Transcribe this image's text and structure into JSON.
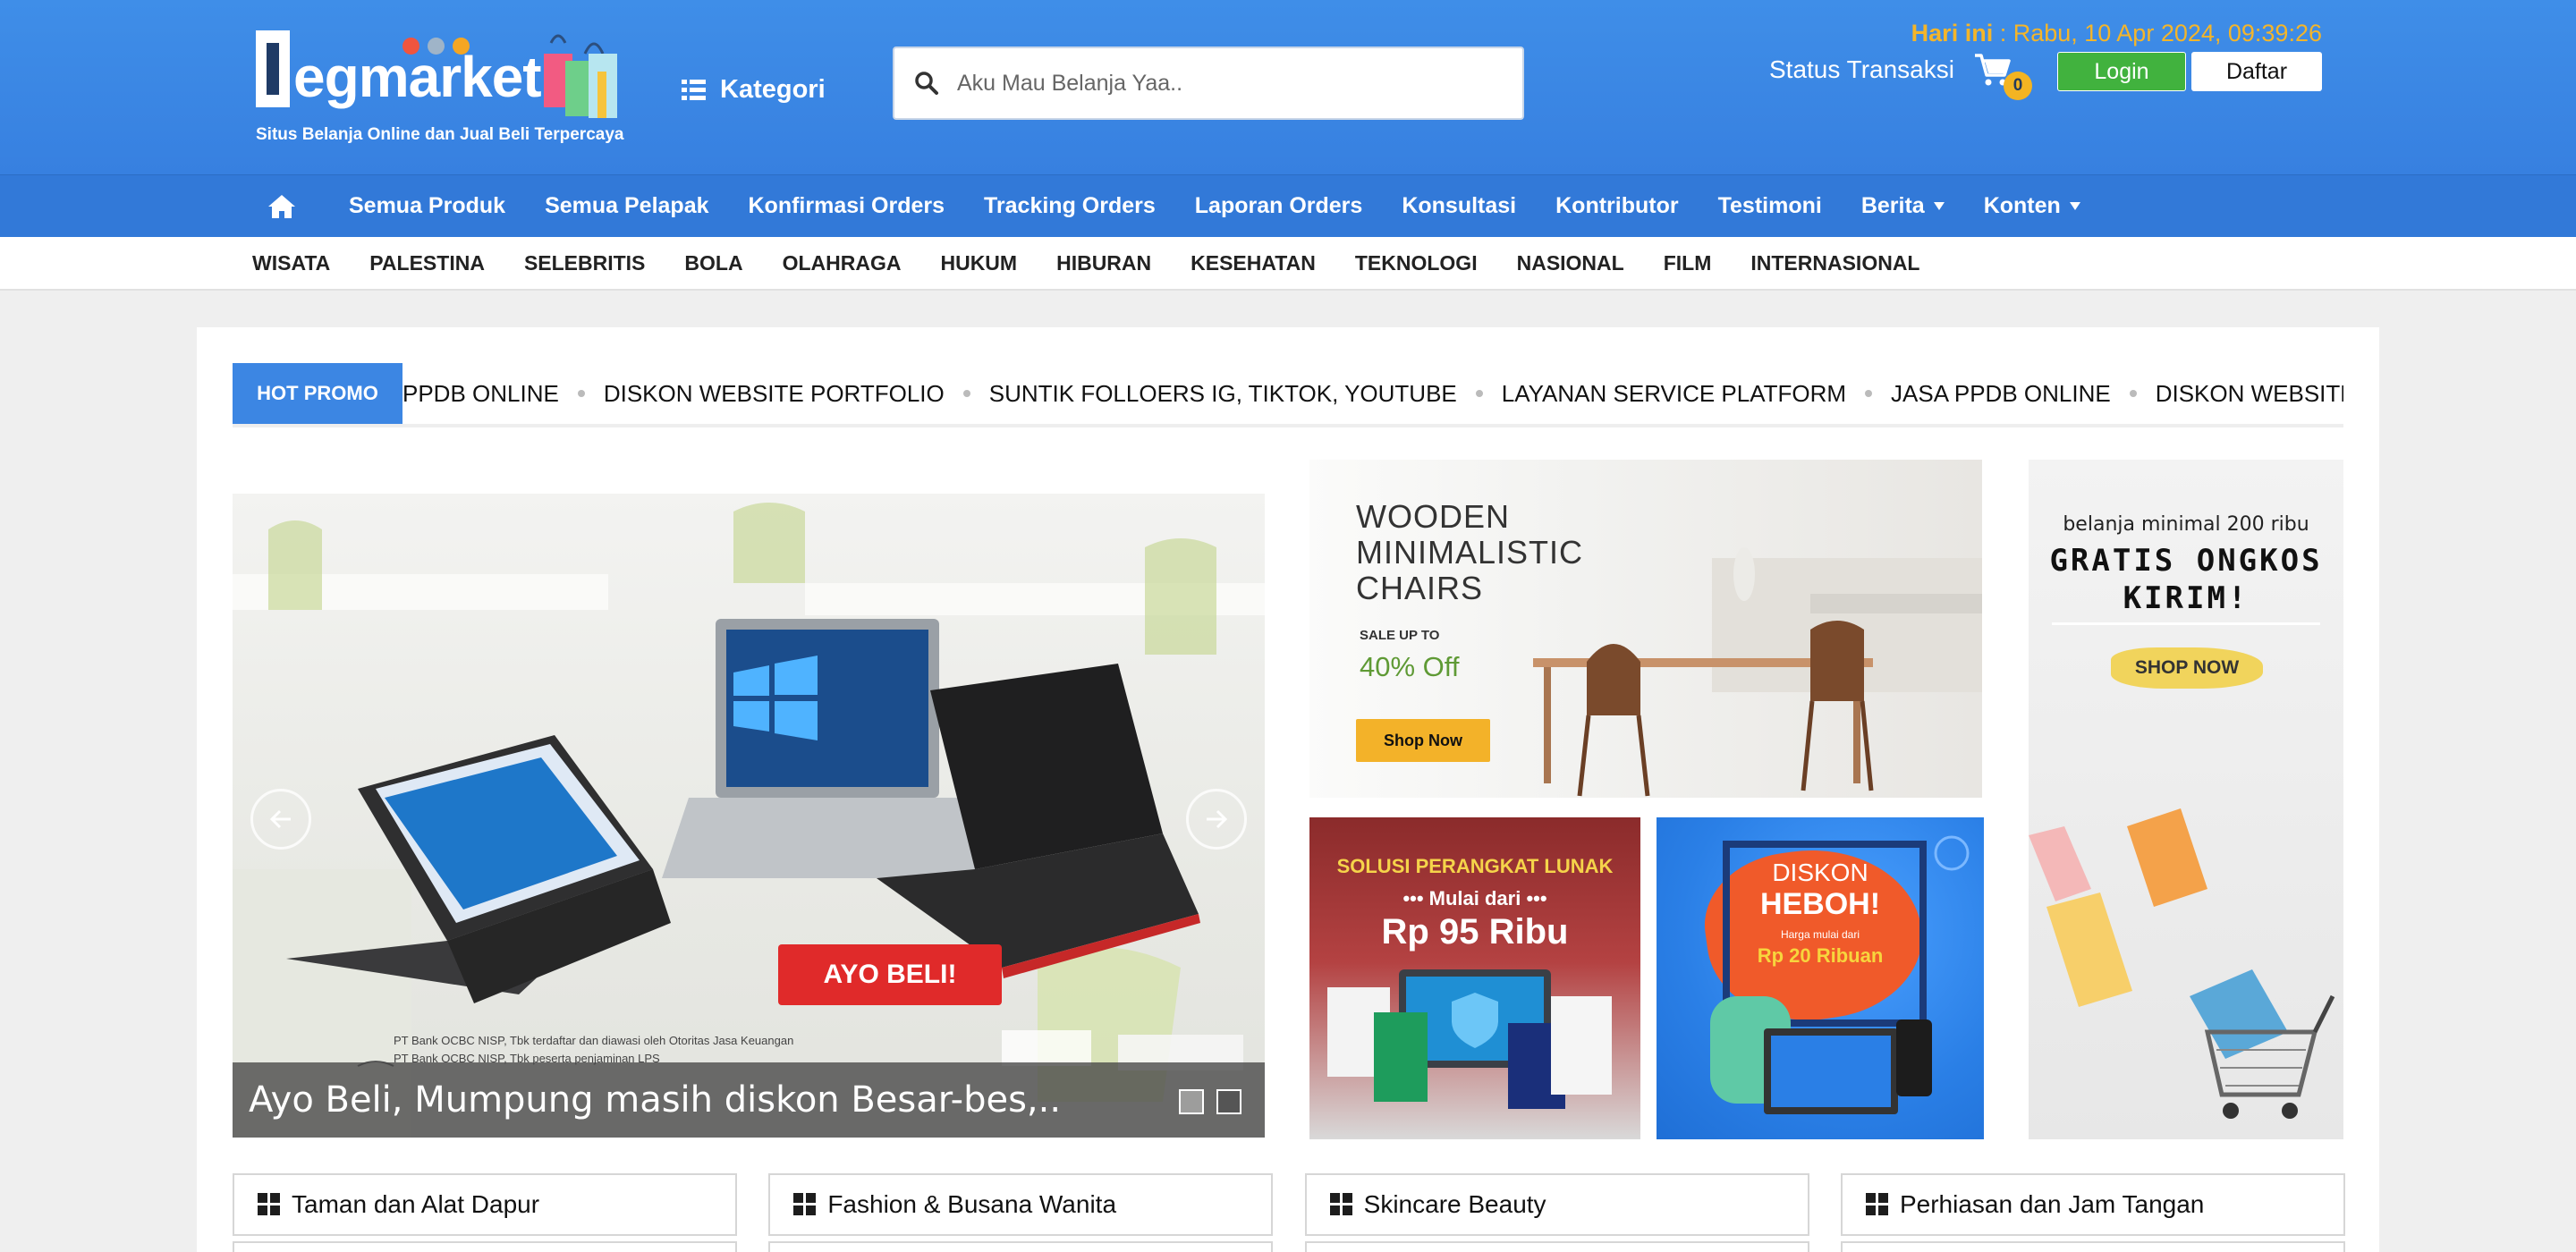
{
  "header": {
    "logo_text": "egmarket",
    "logo_tagline": "Situs Belanja Online dan Jual Beli Terpercaya",
    "kategori_label": "Kategori",
    "search_placeholder": "Aku Mau Belanja Yaa..",
    "date_label": "Hari ini",
    "date_value": " : Rabu, 10 Apr 2024, 09:39:26",
    "status_label": "Status Transaksi",
    "cart_count": "0",
    "login_label": "Login",
    "daftar_label": "Daftar"
  },
  "main_nav": [
    {
      "label": "Semua Produk"
    },
    {
      "label": "Semua Pelapak"
    },
    {
      "label": "Konfirmasi Orders"
    },
    {
      "label": "Tracking Orders"
    },
    {
      "label": "Laporan Orders"
    },
    {
      "label": "Konsultasi"
    },
    {
      "label": "Kontributor"
    },
    {
      "label": "Testimoni"
    },
    {
      "label": "Berita"
    },
    {
      "label": "Konten"
    }
  ],
  "category_nav": [
    "WISATA",
    "PALESTINA",
    "SELEBRITIS",
    "BOLA",
    "OLAHRAGA",
    "HUKUM",
    "HIBURAN",
    "KESEHATAN",
    "TEKNOLOGI",
    "NASIONAL",
    "FILM",
    "INTERNASIONAL"
  ],
  "hot_promo": {
    "label": "HOT PROMO",
    "items": [
      "PPDB ONLINE",
      "DISKON WEBSITE PORTFOLIO",
      "SUNTIK FOLLOERS IG, TIKTOK, YOUTUBE",
      "LAYANAN SERVICE PLATFORM",
      "JASA PPDB ONLINE",
      "DISKON WEBSITE PORTFOLIO"
    ]
  },
  "slider": {
    "caption": "Ayo Beli, Mumpung masih diskon Besar-bes,..",
    "button_text": "AYO BELI!",
    "legal_line1": "PT Bank OCBC NISP, Tbk terdaftar dan diawasi oleh Otoritas Jasa Keuangan",
    "legal_line2": "PT Bank OCBC NISP, Tbk peserta penjaminan LPS"
  },
  "banners": {
    "chairs": {
      "line1": "WOODEN",
      "line2": "MINIMALISTIC",
      "line3": "CHAIRS",
      "sale": "SALE UP TO",
      "pct": "40% Off",
      "button": "Shop Now"
    },
    "software": {
      "line1": "SOLUSI PERANGKAT LUNAK",
      "line2": "••• Mulai dari •••",
      "line3": "Rp 95 Ribu"
    },
    "diskon": {
      "line1": "DISKON",
      "line2": "HEBOH!",
      "line3": "Harga mulai dari",
      "line4": "Rp 20 Ribuan"
    },
    "ongkir": {
      "line1": "belanja minimal 200 ribu",
      "line2": "GRATIS ONGKOS",
      "line3": "KIRIM!",
      "button": "SHOP NOW"
    }
  },
  "categories": [
    "Taman dan Alat Dapur",
    "Fashion & Busana Wanita",
    "Skincare Beauty",
    "Perhiasan dan Jam Tangan"
  ],
  "colors": {
    "header_blue": "#3c88e6",
    "nav_blue": "#3279d8",
    "accent_yellow": "#f4b52a",
    "login_green": "#41b23e"
  }
}
